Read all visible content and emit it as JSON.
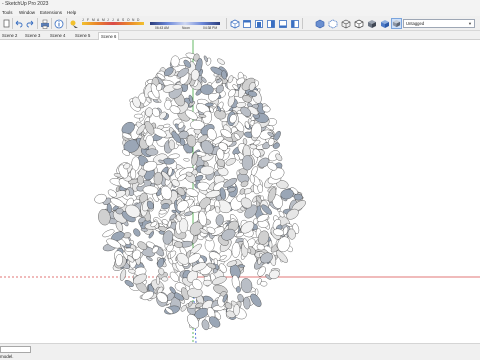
{
  "app": {
    "title": "- SketchUp Pro 2023"
  },
  "menu": {
    "items": [
      "Tools",
      "Window",
      "Extensions",
      "Help"
    ]
  },
  "toolbar": {
    "months": [
      "J",
      "F",
      "M",
      "A",
      "M",
      "J",
      "J",
      "A",
      "S",
      "O",
      "N",
      "D"
    ],
    "time_start": "06:43 AM",
    "time_noon": "Noon",
    "time_end": "04:38 PM",
    "tag_select": {
      "value": "Untagged"
    }
  },
  "tabs": [
    {
      "label": "Scene 2",
      "active": false
    },
    {
      "label": "Scene 3",
      "active": false
    },
    {
      "label": "Scene 4",
      "active": false
    },
    {
      "label": "Scene 5",
      "active": false
    },
    {
      "label": "Scene 6",
      "active": true
    }
  ],
  "status": {
    "text": "model."
  },
  "colors": {
    "axis_green": "#3fa83f",
    "axis_red": "#d94a4a",
    "axis_blue": "#3a5fd6",
    "accent": "#1f6fd1"
  }
}
